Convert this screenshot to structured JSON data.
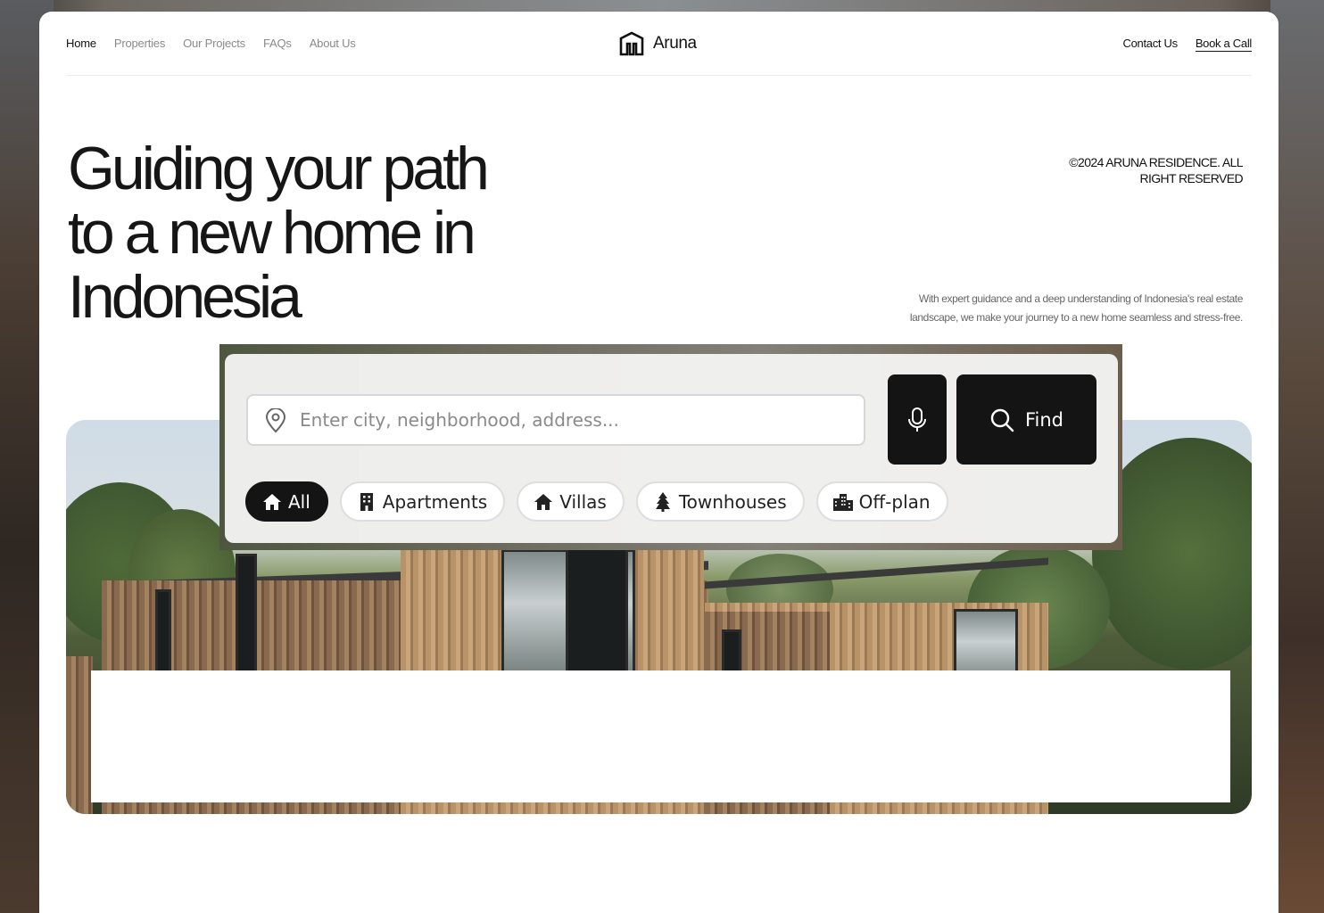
{
  "nav": {
    "links": [
      "Home",
      "Properties",
      "Our Projects",
      "FAQs",
      "About Us"
    ],
    "brand": "Aruna",
    "contact": "Contact Us",
    "book": "Book a Call"
  },
  "hero": {
    "title_line1": "Guiding your path",
    "title_line2": "to a new home in",
    "title_line3": "Indonesia",
    "copyright_line1": "©2024 ARUNA RESIDENCE. ALL",
    "copyright_line2": "RIGHT RESERVED",
    "tagline_line1": "With expert guidance and a deep understanding of Indonesia's real estate",
    "tagline_line2": "landscape, we make your journey to a new home seamless and stress-free."
  },
  "search": {
    "placeholder": "Enter city, neighborhood, address...",
    "find_label": "Find",
    "icons": {
      "location": "map-pin-icon",
      "mic": "microphone-icon",
      "find": "magnifier-icon"
    }
  },
  "filters": [
    {
      "label": "All",
      "icon": "house-icon",
      "active": true
    },
    {
      "label": "Apartments",
      "icon": "building-icon",
      "active": false
    },
    {
      "label": "Villas",
      "icon": "house-icon",
      "active": false
    },
    {
      "label": "Townhouses",
      "icon": "tree-icon",
      "active": false
    },
    {
      "label": "Off-plan",
      "icon": "city-icon",
      "active": false
    }
  ],
  "colors": {
    "dark": "#141414",
    "muted": "#8a8a8a"
  }
}
